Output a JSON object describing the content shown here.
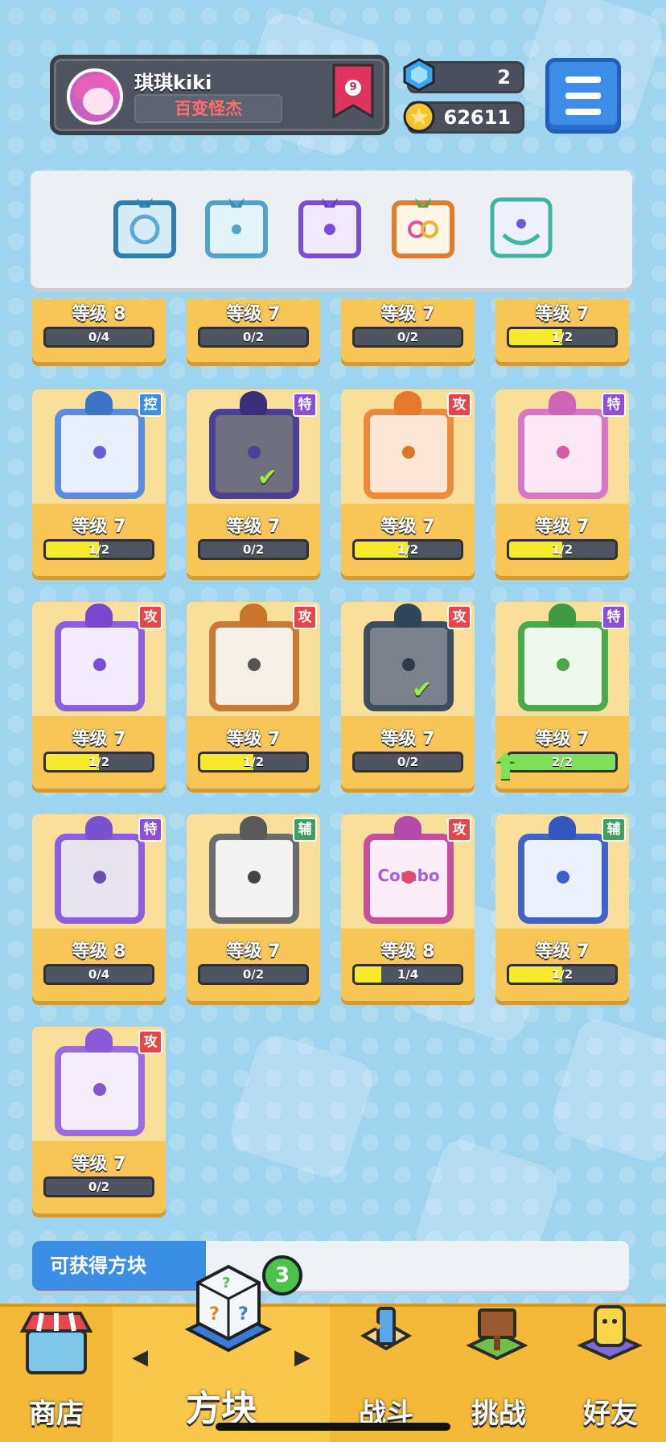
{
  "player": {
    "name": "琪琪kiki",
    "title": "百变怪杰",
    "rank": "9"
  },
  "currency": {
    "gems": "2",
    "coins": "62611"
  },
  "top_row_cards": [
    {
      "level": "等级 8",
      "progress": "0/4",
      "fill": 0
    },
    {
      "level": "等级 7",
      "progress": "0/2",
      "fill": 0
    },
    {
      "level": "等级 7",
      "progress": "0/2",
      "fill": 0
    },
    {
      "level": "等级 7",
      "progress": "1/2",
      "fill": 0.5
    }
  ],
  "cards": [
    {
      "badge": "控",
      "badge_color": "#3f8ee6",
      "level": "等级 7",
      "progress": "1/2",
      "fill": 0.5,
      "border": "#5b8ce0",
      "tile_bg": "#e8f0fb",
      "pip": "#6e5bd6",
      "dragon": "#3e74c7"
    },
    {
      "badge": "特",
      "badge_color": "#8f4ed8",
      "level": "等级 7",
      "progress": "0/2",
      "fill": 0,
      "border": "#4b3f96",
      "tile_bg": "#6f6f7e",
      "pip": "#4b3f96",
      "dragon": "#3b2f7a",
      "check": true
    },
    {
      "badge": "攻",
      "badge_color": "#e5464a",
      "level": "等级 7",
      "progress": "1/2",
      "fill": 0.5,
      "border": "#ee8a3b",
      "tile_bg": "#fbe7d3",
      "pip": "#d9772d",
      "dragon": "#e57a2a"
    },
    {
      "badge": "特",
      "badge_color": "#8f4ed8",
      "level": "等级 7",
      "progress": "1/2",
      "fill": 0.5,
      "border": "#d977c6",
      "tile_bg": "#fbe8f3",
      "pip": "#d65aa5",
      "dragon": "#cc64b7"
    },
    {
      "badge": "攻",
      "badge_color": "#e5464a",
      "level": "等级 7",
      "progress": "1/2",
      "fill": 0.5,
      "border": "#8b5fe0",
      "tile_bg": "#f1ebfc",
      "pip": "#7b4cd6",
      "dragon": "#7747d0"
    },
    {
      "badge": "攻",
      "badge_color": "#e5464a",
      "level": "等级 7",
      "progress": "1/2",
      "fill": 0.5,
      "border": "#c77b35",
      "tile_bg": "#f5efe8",
      "pip": "#555555",
      "dragon": "#c9762b"
    },
    {
      "badge": "攻",
      "badge_color": "#e5464a",
      "level": "等级 7",
      "progress": "0/2",
      "fill": 0,
      "border": "#3c4e5e",
      "tile_bg": "#7b828c",
      "pip": "#2e3c4a",
      "dragon": "#2f4657",
      "check": true
    },
    {
      "badge": "特",
      "badge_color": "#8f4ed8",
      "level": "等级 7",
      "progress": "2/2",
      "fill": 1,
      "green": true,
      "upgrade": true,
      "border": "#4aaa4b",
      "tile_bg": "#eef8ec",
      "pip": "#48a84a",
      "dragon": "#3f9a41"
    },
    {
      "badge": "特",
      "badge_color": "#8f4ed8",
      "level": "等级 8",
      "progress": "0/4",
      "fill": 0,
      "border": "#8b5fe0",
      "tile_bg": "#e8e4ef",
      "pip": "#6b4fb0",
      "dragon": "#7a52cf"
    },
    {
      "badge": "辅",
      "badge_color": "#3ea05a",
      "level": "等级 7",
      "progress": "0/2",
      "fill": 0,
      "border": "#6c6c6c",
      "tile_bg": "#f3f3f3",
      "pip": "#444444",
      "dragon": "#5a5a5a"
    },
    {
      "badge": "攻",
      "badge_color": "#e5464a",
      "level": "等级 8",
      "progress": "1/4",
      "fill": 0.25,
      "border": "#c84f9c",
      "tile_bg": "#fbeef7",
      "pip": "#e04a6a",
      "dragon": "#b64aa8",
      "art_text": "Combo"
    },
    {
      "badge": "辅",
      "badge_color": "#3ea05a",
      "level": "等级 7",
      "progress": "1/2",
      "fill": 0.5,
      "border": "#3f63c9",
      "tile_bg": "#eaf0fc",
      "pip": "#3a5fd0",
      "dragon": "#3457bf"
    },
    {
      "badge": "攻",
      "badge_color": "#e5464a",
      "level": "等级 7",
      "progress": "0/2",
      "fill": 0,
      "border": "#9b6be0",
      "tile_bg": "#f4eefc",
      "pip": "#8658cf",
      "dragon": "#8b5ad8"
    }
  ],
  "obtainable": {
    "label": "可获得方块",
    "count": "3"
  },
  "nav": {
    "shop": "商店",
    "blocks": "方块",
    "battle": "战斗",
    "challenge": "挑战",
    "friends": "好友",
    "left_arrow": "◀",
    "right_arrow": "▶"
  }
}
